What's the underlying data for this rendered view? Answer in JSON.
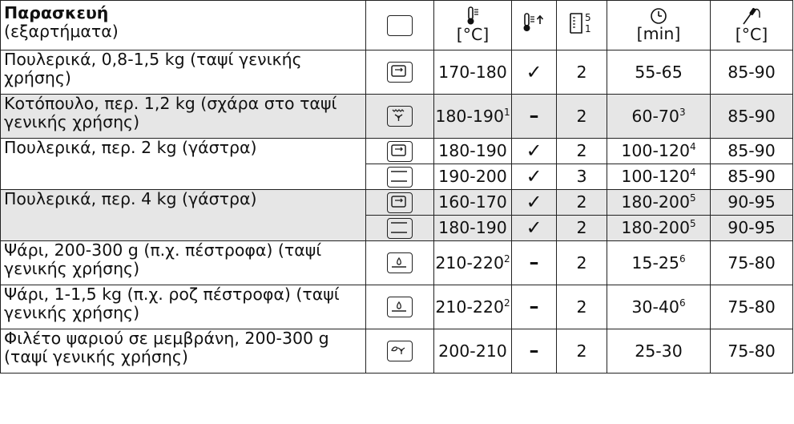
{
  "header": {
    "dish_title": "Παρασκευή",
    "dish_subtitle": "(εξαρτήματα)",
    "temp_unit": "[°C]",
    "levels_top": "5",
    "levels_bottom": "1",
    "time_unit": "[min]",
    "core_unit": "[°C]",
    "icons": {
      "mode": "oven-mode-icon",
      "temp": "thermometer-icon",
      "boost": "rapid-heat-icon",
      "levels": "shelf-levels-icon",
      "time": "clock-icon",
      "core": "food-probe-icon"
    }
  },
  "rows": [
    {
      "dish": "Πουλερικά, 0,8-1,5 kg (ταψί γενικής χρήσης)",
      "mode": "convection",
      "temp": "170-180",
      "temp_sup": "",
      "boost": "✓",
      "level": "2",
      "time": "55-65",
      "time_sup": "",
      "core": "85-90"
    },
    {
      "dish": "Κοτόπουλο, περ. 1,2 kg (σχάρα στο ταψί γενικής χρήσης)",
      "mode": "fan-grill",
      "temp": "180-190",
      "temp_sup": "1",
      "boost": "–",
      "level": "2",
      "time": "60-70",
      "time_sup": "3",
      "core": "85-90"
    },
    {
      "dish": "Πουλερικά, περ. 2 kg (γάστρα)",
      "mode": "convection",
      "temp": "180-190",
      "temp_sup": "",
      "boost": "✓",
      "level": "2",
      "time": "100-120",
      "time_sup": "4",
      "core": "85-90"
    },
    {
      "dish": "",
      "mode": "conventional",
      "temp": "190-200",
      "temp_sup": "",
      "boost": "✓",
      "level": "3",
      "time": "100-120",
      "time_sup": "4",
      "core": "85-90"
    },
    {
      "dish": "Πουλερικά, περ. 4 kg (γάστρα)",
      "mode": "convection",
      "temp": "160-170",
      "temp_sup": "",
      "boost": "✓",
      "level": "2",
      "time": "180-200",
      "time_sup": "5",
      "core": "90-95"
    },
    {
      "dish": "",
      "mode": "conventional",
      "temp": "180-190",
      "temp_sup": "",
      "boost": "✓",
      "level": "2",
      "time": "180-200",
      "time_sup": "5",
      "core": "90-95"
    },
    {
      "dish": "Ψάρι, 200-300 g (π.χ. πέστροφα) (ταψί γενικής χρήσης)",
      "mode": "bottom-heat",
      "temp": "210-220",
      "temp_sup": "2",
      "boost": "–",
      "level": "2",
      "time": "15-25",
      "time_sup": "6",
      "core": "75-80"
    },
    {
      "dish": "Ψάρι, 1-1,5 kg (π.χ. ροζ πέστροφα) (ταψί γενικής χρήσης)",
      "mode": "bottom-heat",
      "temp": "210-220",
      "temp_sup": "2",
      "boost": "–",
      "level": "2",
      "time": "30-40",
      "time_sup": "6",
      "core": "75-80"
    },
    {
      "dish": "Φιλέτο ψαριού σε μεμβράνη, 200-300 g (ταψί γενικής χρήσης)",
      "mode": "eco-fan",
      "temp": "200-210",
      "temp_sup": "",
      "boost": "–",
      "level": "2",
      "time": "25-30",
      "time_sup": "",
      "core": "75-80"
    }
  ]
}
